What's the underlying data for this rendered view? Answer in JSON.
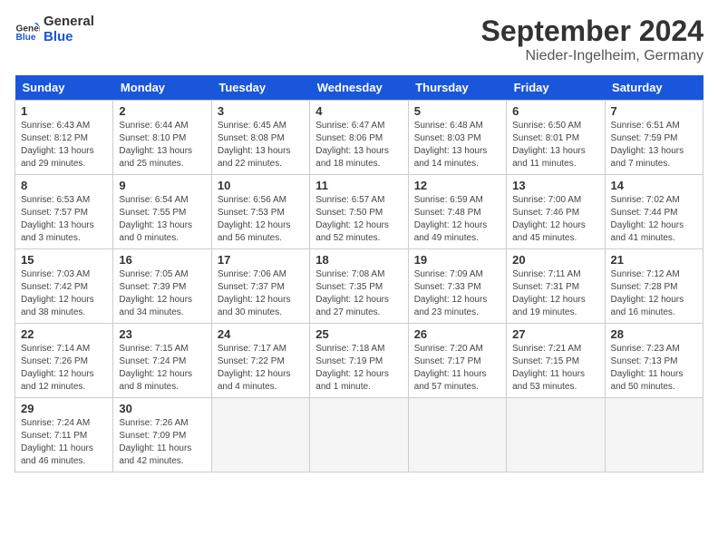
{
  "header": {
    "logo_line1": "General",
    "logo_line2": "Blue",
    "title": "September 2024",
    "subtitle": "Nieder-Ingelheim, Germany"
  },
  "calendar": {
    "days_of_week": [
      "Sunday",
      "Monday",
      "Tuesday",
      "Wednesday",
      "Thursday",
      "Friday",
      "Saturday"
    ],
    "weeks": [
      [
        {
          "day": "",
          "empty": true
        },
        {
          "day": "",
          "empty": true
        },
        {
          "day": "",
          "empty": true
        },
        {
          "day": "",
          "empty": true
        },
        {
          "day": "",
          "empty": true
        },
        {
          "day": "",
          "empty": true
        },
        {
          "day": "",
          "empty": true
        }
      ],
      [
        {
          "day": "1",
          "sunrise": "6:43 AM",
          "sunset": "8:12 PM",
          "daylight": "13 hours and 29 minutes."
        },
        {
          "day": "2",
          "sunrise": "6:44 AM",
          "sunset": "8:10 PM",
          "daylight": "13 hours and 25 minutes."
        },
        {
          "day": "3",
          "sunrise": "6:45 AM",
          "sunset": "8:08 PM",
          "daylight": "13 hours and 22 minutes."
        },
        {
          "day": "4",
          "sunrise": "6:47 AM",
          "sunset": "8:06 PM",
          "daylight": "13 hours and 18 minutes."
        },
        {
          "day": "5",
          "sunrise": "6:48 AM",
          "sunset": "8:03 PM",
          "daylight": "13 hours and 14 minutes."
        },
        {
          "day": "6",
          "sunrise": "6:50 AM",
          "sunset": "8:01 PM",
          "daylight": "13 hours and 11 minutes."
        },
        {
          "day": "7",
          "sunrise": "6:51 AM",
          "sunset": "7:59 PM",
          "daylight": "13 hours and 7 minutes."
        }
      ],
      [
        {
          "day": "8",
          "sunrise": "6:53 AM",
          "sunset": "7:57 PM",
          "daylight": "13 hours and 3 minutes."
        },
        {
          "day": "9",
          "sunrise": "6:54 AM",
          "sunset": "7:55 PM",
          "daylight": "13 hours and 0 minutes."
        },
        {
          "day": "10",
          "sunrise": "6:56 AM",
          "sunset": "7:53 PM",
          "daylight": "12 hours and 56 minutes."
        },
        {
          "day": "11",
          "sunrise": "6:57 AM",
          "sunset": "7:50 PM",
          "daylight": "12 hours and 52 minutes."
        },
        {
          "day": "12",
          "sunrise": "6:59 AM",
          "sunset": "7:48 PM",
          "daylight": "12 hours and 49 minutes."
        },
        {
          "day": "13",
          "sunrise": "7:00 AM",
          "sunset": "7:46 PM",
          "daylight": "12 hours and 45 minutes."
        },
        {
          "day": "14",
          "sunrise": "7:02 AM",
          "sunset": "7:44 PM",
          "daylight": "12 hours and 41 minutes."
        }
      ],
      [
        {
          "day": "15",
          "sunrise": "7:03 AM",
          "sunset": "7:42 PM",
          "daylight": "12 hours and 38 minutes."
        },
        {
          "day": "16",
          "sunrise": "7:05 AM",
          "sunset": "7:39 PM",
          "daylight": "12 hours and 34 minutes."
        },
        {
          "day": "17",
          "sunrise": "7:06 AM",
          "sunset": "7:37 PM",
          "daylight": "12 hours and 30 minutes."
        },
        {
          "day": "18",
          "sunrise": "7:08 AM",
          "sunset": "7:35 PM",
          "daylight": "12 hours and 27 minutes."
        },
        {
          "day": "19",
          "sunrise": "7:09 AM",
          "sunset": "7:33 PM",
          "daylight": "12 hours and 23 minutes."
        },
        {
          "day": "20",
          "sunrise": "7:11 AM",
          "sunset": "7:31 PM",
          "daylight": "12 hours and 19 minutes."
        },
        {
          "day": "21",
          "sunrise": "7:12 AM",
          "sunset": "7:28 PM",
          "daylight": "12 hours and 16 minutes."
        }
      ],
      [
        {
          "day": "22",
          "sunrise": "7:14 AM",
          "sunset": "7:26 PM",
          "daylight": "12 hours and 12 minutes."
        },
        {
          "day": "23",
          "sunrise": "7:15 AM",
          "sunset": "7:24 PM",
          "daylight": "12 hours and 8 minutes."
        },
        {
          "day": "24",
          "sunrise": "7:17 AM",
          "sunset": "7:22 PM",
          "daylight": "12 hours and 4 minutes."
        },
        {
          "day": "25",
          "sunrise": "7:18 AM",
          "sunset": "7:19 PM",
          "daylight": "12 hours and 1 minute."
        },
        {
          "day": "26",
          "sunrise": "7:20 AM",
          "sunset": "7:17 PM",
          "daylight": "11 hours and 57 minutes."
        },
        {
          "day": "27",
          "sunrise": "7:21 AM",
          "sunset": "7:15 PM",
          "daylight": "11 hours and 53 minutes."
        },
        {
          "day": "28",
          "sunrise": "7:23 AM",
          "sunset": "7:13 PM",
          "daylight": "11 hours and 50 minutes."
        }
      ],
      [
        {
          "day": "29",
          "sunrise": "7:24 AM",
          "sunset": "7:11 PM",
          "daylight": "11 hours and 46 minutes."
        },
        {
          "day": "30",
          "sunrise": "7:26 AM",
          "sunset": "7:09 PM",
          "daylight": "11 hours and 42 minutes."
        },
        {
          "day": "",
          "empty": true
        },
        {
          "day": "",
          "empty": true
        },
        {
          "day": "",
          "empty": true
        },
        {
          "day": "",
          "empty": true
        },
        {
          "day": "",
          "empty": true
        }
      ]
    ]
  }
}
